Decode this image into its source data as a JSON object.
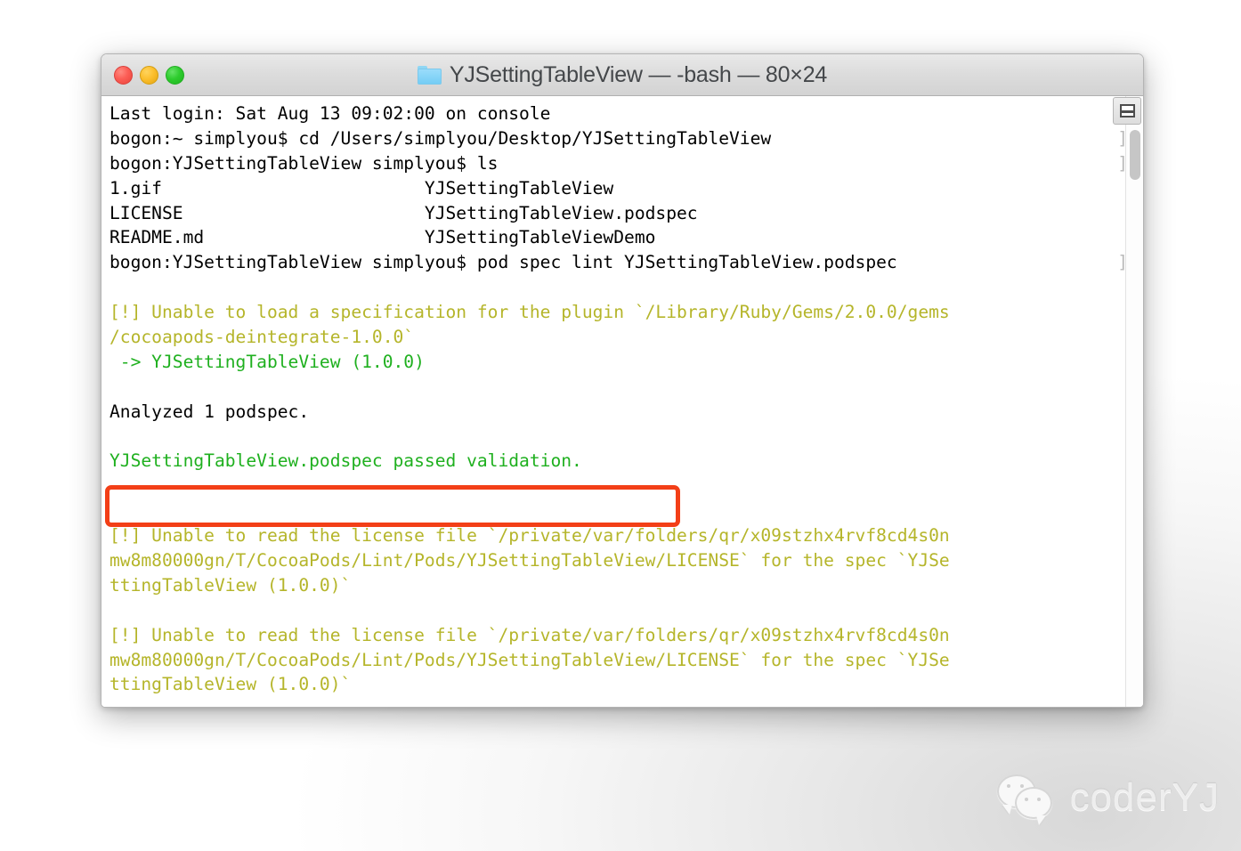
{
  "window": {
    "title": "YJSettingTableView — -bash — 80×24",
    "folder_icon": "folder-icon",
    "traffic_lights": {
      "close": "close-button",
      "minimize": "minimize-button",
      "zoom": "zoom-button"
    },
    "split_button_icon": "split-pane-icon",
    "colors": {
      "titlebar_text": "#44474a",
      "folder": "#74cdf5",
      "close": "#fc5d55",
      "minimize": "#fcbf2e",
      "maximize": "#2ecc2e"
    }
  },
  "terminal": {
    "columns": 80,
    "rows": 24,
    "shell": "-bash",
    "colors": {
      "background": "#ffffff",
      "foreground": "#000000",
      "warning": "#b5b52a",
      "success": "#2bb12b",
      "annotation": "#f33f17"
    },
    "lines": [
      {
        "text": "Last login: Sat Aug 13 09:02:00 on console",
        "color": "default"
      },
      {
        "text": "bogon:~ simplyou$ cd /Users/simplyou/Desktop/YJSettingTableView",
        "color": "default"
      },
      {
        "text": "bogon:YJSettingTableView simplyou$ ls",
        "color": "default"
      },
      {
        "text": "1.gif                         YJSettingTableView",
        "color": "default"
      },
      {
        "text": "LICENSE                       YJSettingTableView.podspec",
        "color": "default"
      },
      {
        "text": "README.md                     YJSettingTableViewDemo",
        "color": "default"
      },
      {
        "text": "bogon:YJSettingTableView simplyou$ pod spec lint YJSettingTableView.podspec",
        "color": "default"
      },
      {
        "text": "",
        "color": "default"
      },
      {
        "text": "[!] Unable to load a specification for the plugin `/Library/Ruby/Gems/2.0.0/gems",
        "color": "warn"
      },
      {
        "text": "/cocoapods-deintegrate-1.0.0`",
        "color": "warn"
      },
      {
        "text": " -> YJSettingTableView (1.0.0)",
        "color": "success"
      },
      {
        "text": "",
        "color": "default"
      },
      {
        "text": "Analyzed 1 podspec.",
        "color": "default"
      },
      {
        "text": "",
        "color": "default"
      },
      {
        "text": "YJSettingTableView.podspec passed validation.",
        "color": "success"
      },
      {
        "text": "",
        "color": "default"
      },
      {
        "text": "",
        "color": "default"
      },
      {
        "text": "[!] Unable to read the license file `/private/var/folders/qr/x09stzhx4rvf8cd4s0n",
        "color": "warn"
      },
      {
        "text": "mw8m80000gn/T/CocoaPods/Lint/Pods/YJSettingTableView/LICENSE` for the spec `YJSe",
        "color": "warn"
      },
      {
        "text": "ttingTableView (1.0.0)`",
        "color": "warn"
      },
      {
        "text": "",
        "color": "default"
      },
      {
        "text": "[!] Unable to read the license file `/private/var/folders/qr/x09stzhx4rvf8cd4s0n",
        "color": "warn"
      },
      {
        "text": "mw8m80000gn/T/CocoaPods/Lint/Pods/YJSettingTableView/LICENSE` for the spec `YJSe",
        "color": "warn"
      },
      {
        "text": "ttingTableView (1.0.0)`",
        "color": "warn"
      }
    ],
    "wrap_markers": "\n]\n]\n\n\n\n]\n\n\n\n\n\n\n\n\n\n\n\n\n\n\n\n\n",
    "highlight": {
      "line_text": "YJSettingTableView.podspec passed validation.",
      "border_color": "#f33f17"
    },
    "scrollbar": {
      "thumb_color": "#c6c6c6"
    }
  },
  "watermark": {
    "icon": "wechat-icon",
    "text": "coderYJ"
  }
}
